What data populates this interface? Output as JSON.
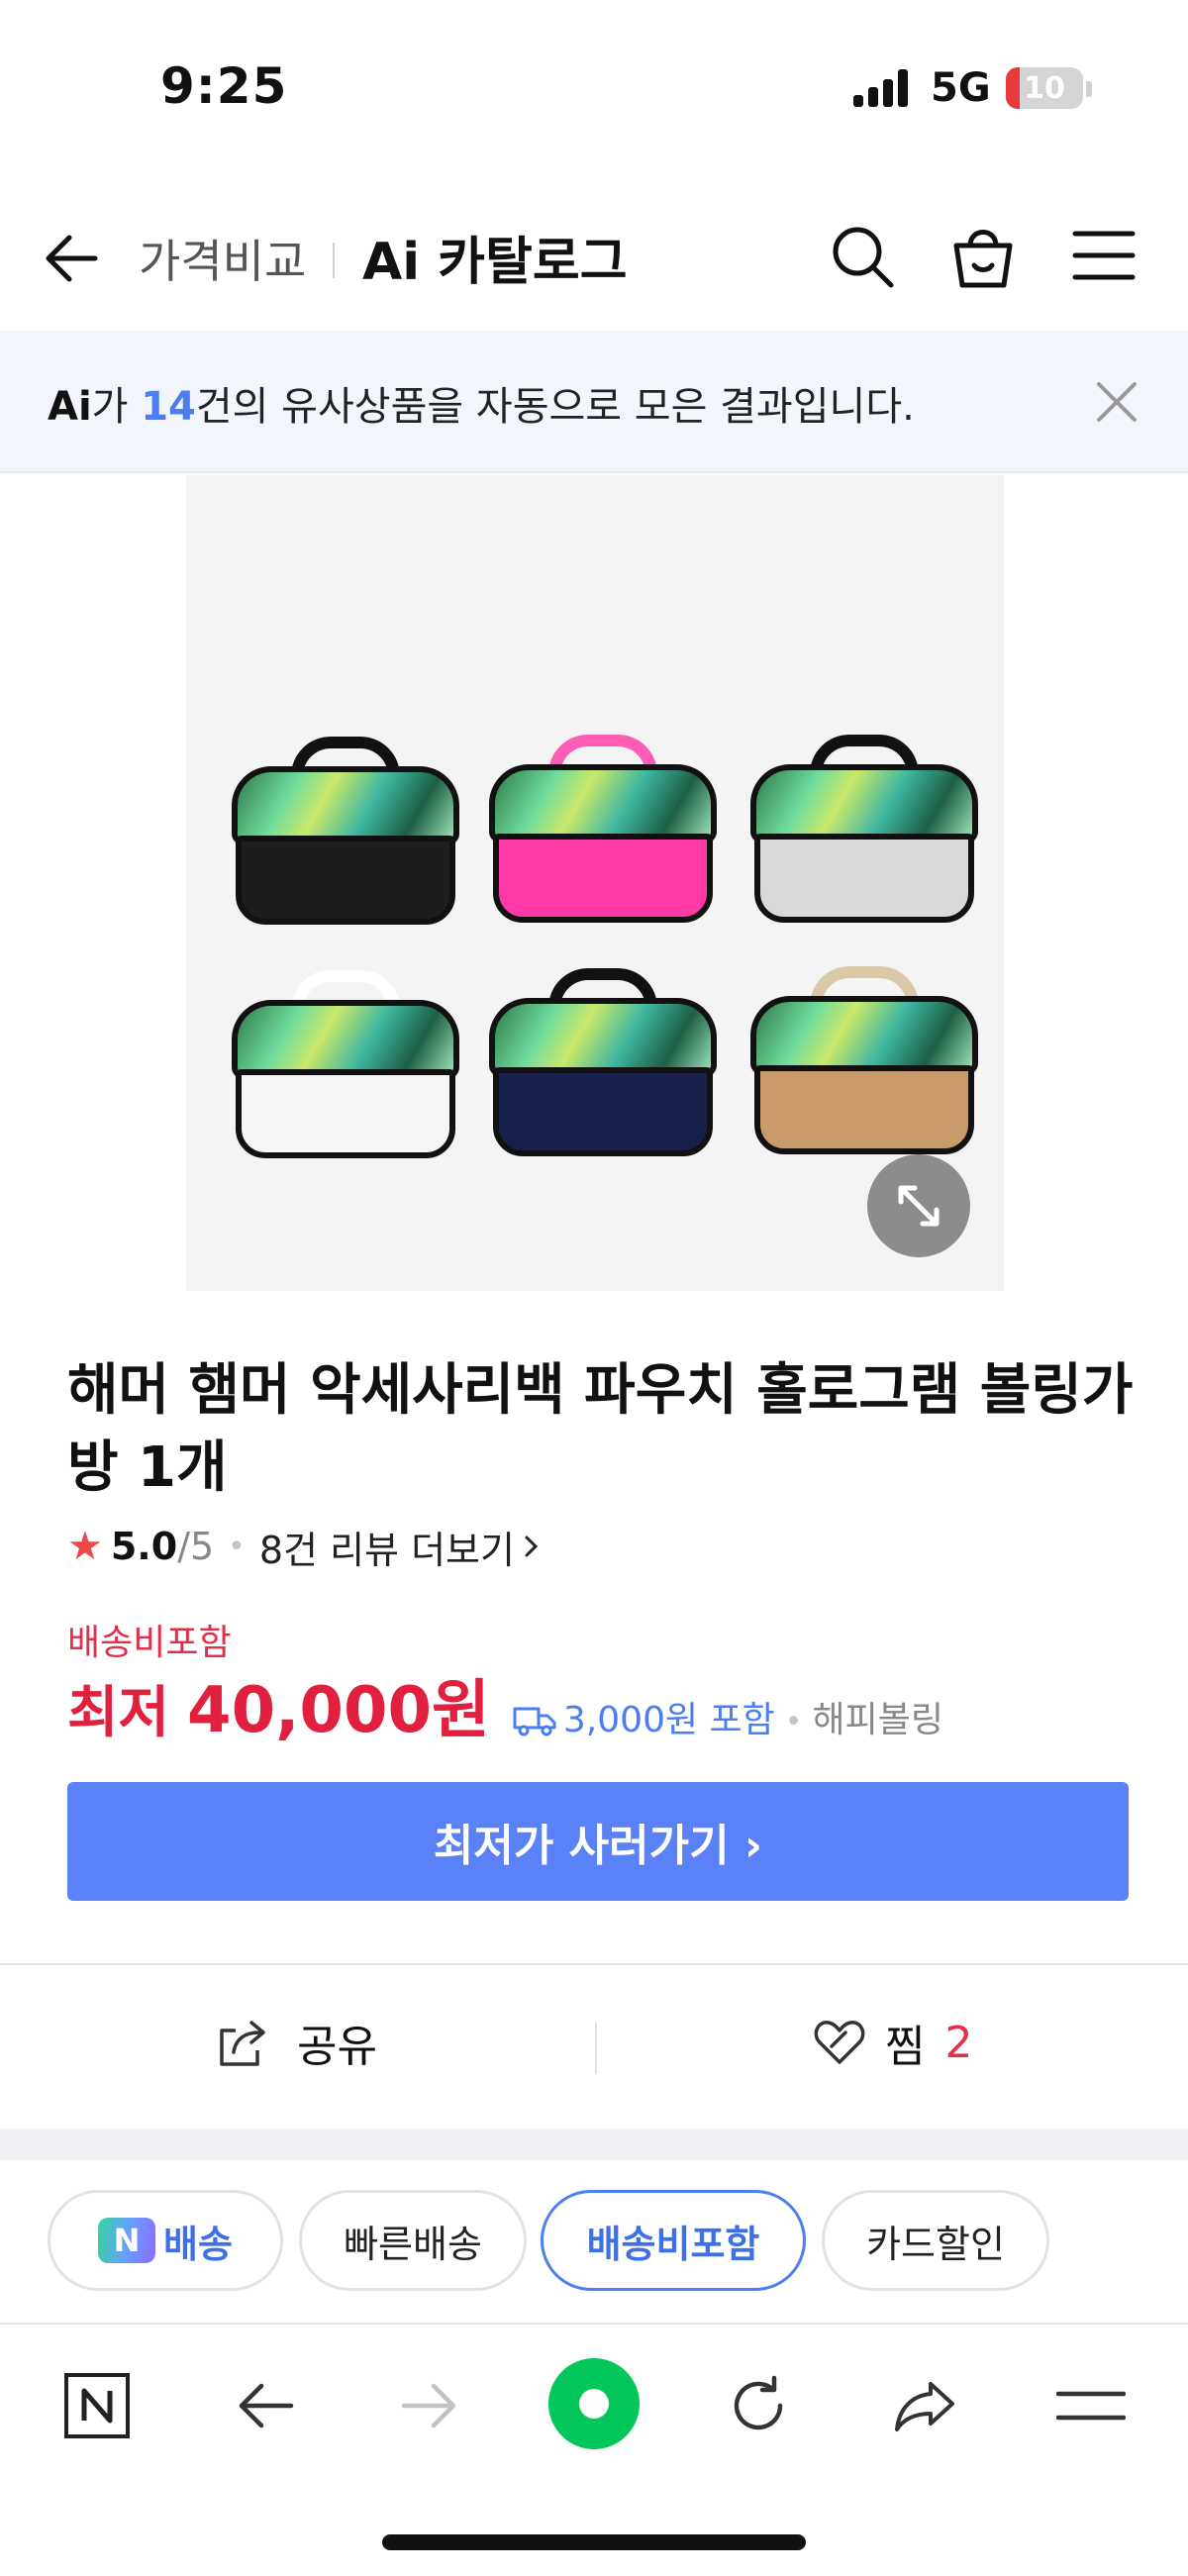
{
  "status_bar": {
    "time": "9:25",
    "network": "5G",
    "battery": "10"
  },
  "header": {
    "back_label": "",
    "breadcrumb": "가격비교",
    "title": "Ai 카탈로그"
  },
  "ai_banner": {
    "mark": "Ai",
    "text_before": "가 ",
    "count": "14",
    "text_after": "건의 유사상품을 자동으로 모은 결과입니다."
  },
  "product": {
    "title": "해머 햄머 악세사리백 파우치 홀로그램 볼링가방 1개",
    "rating": "5.0",
    "rating_max": "/5",
    "review_link": "8건 리뷰 더보기",
    "shipping_label": "배송비포함",
    "price_prefix": "최저",
    "price": "40,000원",
    "shipping_fee": "3,000원 포함",
    "seller": "해피볼링",
    "image_colors": [
      "#1d1d1d",
      "#ff3aa6",
      "#d9d9d9",
      "#f5f5f5",
      "#17204a",
      "#c99a6a"
    ]
  },
  "buy_button": {
    "label": "최저가 사러가기 ›"
  },
  "actions": {
    "share_label": "공유",
    "wish_label": "찜",
    "wish_count": "2"
  },
  "filter_chips": [
    {
      "label": "배송",
      "badge": "N",
      "selected": false
    },
    {
      "label": "빠른배송",
      "selected": false
    },
    {
      "label": "배송비포함",
      "selected": true
    },
    {
      "label": "카드할인",
      "selected": false
    }
  ],
  "colors": {
    "accent": "#5a82f6",
    "price_red": "#e0203e",
    "link_blue": "#4b7ef2",
    "green": "#03c75a"
  }
}
